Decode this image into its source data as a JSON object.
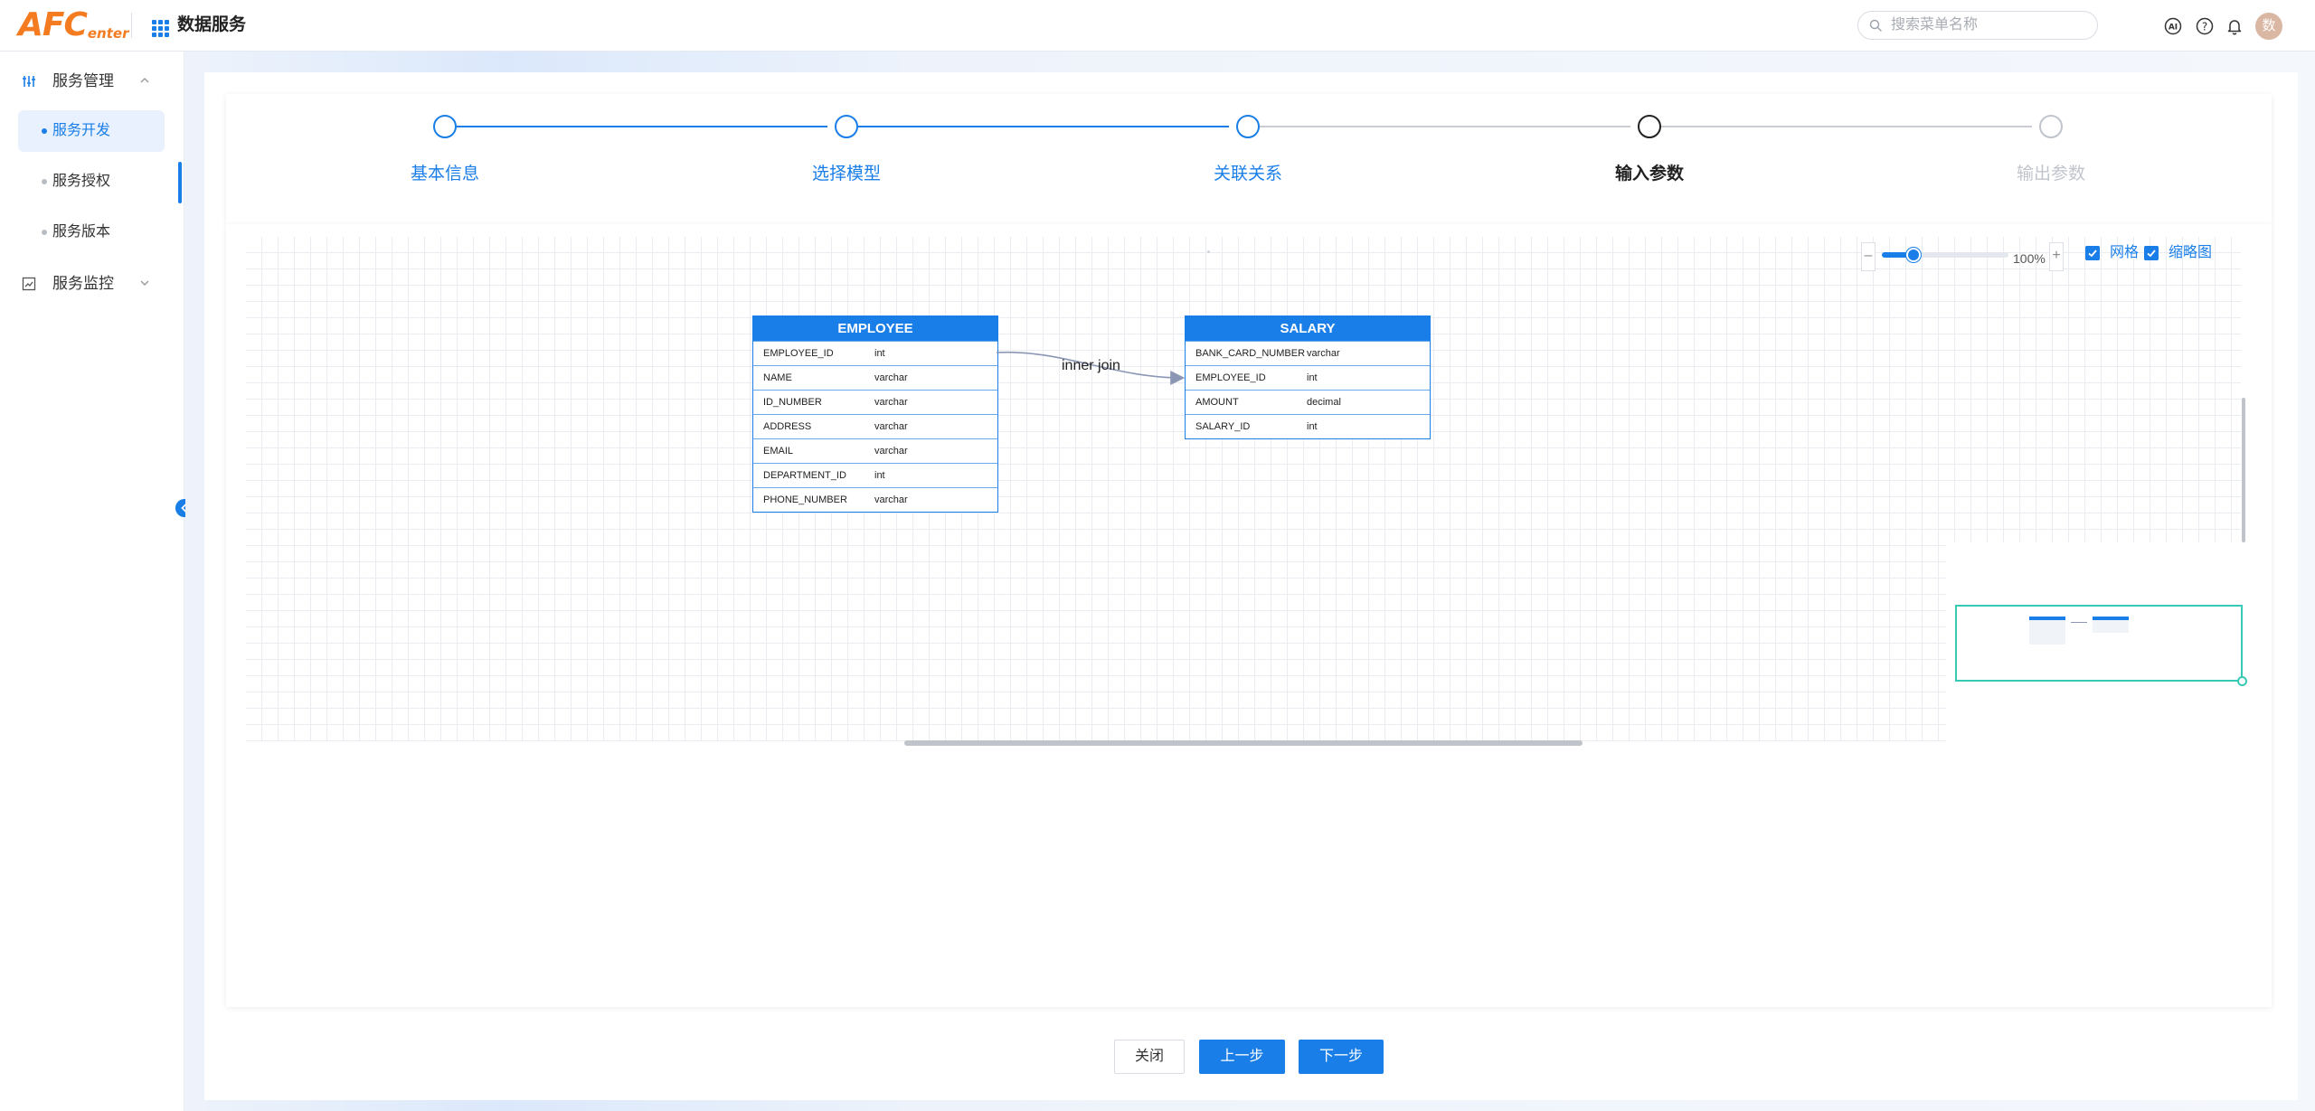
{
  "header": {
    "logo_main": "AFC",
    "logo_sub": "enter",
    "app_title": "数据服务",
    "search_placeholder": "搜索菜单名称",
    "avatar_text": "数"
  },
  "sidebar": {
    "groups": [
      {
        "label": "服务管理",
        "expanded": true
      },
      {
        "label": "服务监控",
        "expanded": false
      }
    ],
    "items": [
      {
        "label": "服务开发",
        "active": true
      },
      {
        "label": "服务授权",
        "active": false
      },
      {
        "label": "服务版本",
        "active": false
      }
    ]
  },
  "steps": [
    {
      "label": "基本信息",
      "status": "done"
    },
    {
      "label": "选择模型",
      "status": "done"
    },
    {
      "label": "关联关系",
      "status": "done"
    },
    {
      "label": "输入参数",
      "status": "current"
    },
    {
      "label": "输出参数",
      "status": "pending"
    }
  ],
  "canvas": {
    "zoom_label": "100%",
    "zoom_level": 0.25,
    "grid_label": "网格",
    "grid_checked": true,
    "minimap_label": "缩略图",
    "minimap_checked": true,
    "join_label": "inner join"
  },
  "entities": [
    {
      "name": "EMPLOYEE",
      "fields": [
        {
          "name": "EMPLOYEE_ID",
          "type": "int"
        },
        {
          "name": "NAME",
          "type": "varchar"
        },
        {
          "name": "ID_NUMBER",
          "type": "varchar"
        },
        {
          "name": "ADDRESS",
          "type": "varchar"
        },
        {
          "name": "EMAIL",
          "type": "varchar"
        },
        {
          "name": "DEPARTMENT_ID",
          "type": "int"
        },
        {
          "name": "PHONE_NUMBER",
          "type": "varchar"
        }
      ]
    },
    {
      "name": "SALARY",
      "fields": [
        {
          "name": "BANK_CARD_NUMBER",
          "type": "varchar"
        },
        {
          "name": "EMPLOYEE_ID",
          "type": "int"
        },
        {
          "name": "AMOUNT",
          "type": "decimal"
        },
        {
          "name": "SALARY_ID",
          "type": "int"
        }
      ]
    }
  ],
  "footer": {
    "close_label": "关闭",
    "prev_label": "上一步",
    "next_label": "下一步"
  },
  "colors": {
    "primary": "#1a7ee8",
    "logo": "#f47b20",
    "minimap_border": "#36c9b4",
    "pending": "#c0c4cc"
  }
}
